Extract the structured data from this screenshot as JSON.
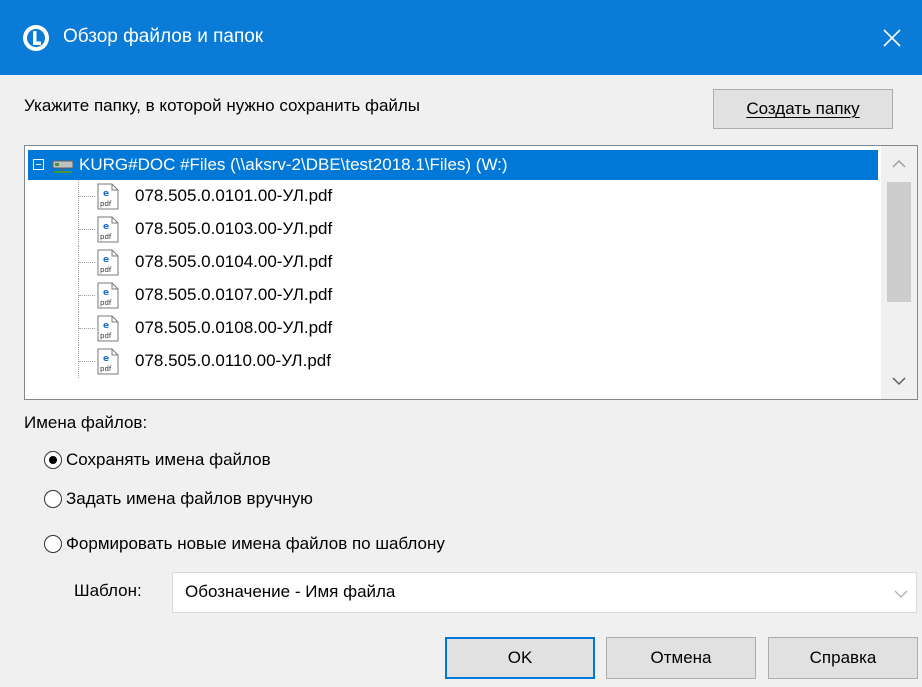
{
  "window": {
    "title": "Обзор файлов и папок",
    "title_bar_color": "#0a7bd6",
    "icon": "app-logo-icon",
    "close_icon": "close-icon"
  },
  "instruction": "Укажите папку, в которой нужно сохранить файлы",
  "create_folder_button": "Создать папку",
  "tree": {
    "root": {
      "label": "KURG#DOC #Files (\\\\aksrv-2\\DBE\\test2018.1\\Files) (W:)",
      "icon": "network-drive-icon",
      "expanded": true,
      "selected": true
    },
    "items": [
      {
        "label": "078.505.0.0101.00-УЛ.pdf",
        "icon": "pdf-file-icon"
      },
      {
        "label": "078.505.0.0103.00-УЛ.pdf",
        "icon": "pdf-file-icon"
      },
      {
        "label": "078.505.0.0104.00-УЛ.pdf",
        "icon": "pdf-file-icon"
      },
      {
        "label": "078.505.0.0107.00-УЛ.pdf",
        "icon": "pdf-file-icon"
      },
      {
        "label": "078.505.0.0108.00-УЛ.pdf",
        "icon": "pdf-file-icon"
      },
      {
        "label": "078.505.0.0110.00-УЛ.pdf",
        "icon": "pdf-file-icon"
      }
    ]
  },
  "file_names": {
    "label": "Имена файлов:",
    "options": [
      {
        "label": "Сохранять имена файлов",
        "checked": true
      },
      {
        "label": "Задать имена файлов вручную",
        "checked": false
      },
      {
        "label": "Формировать новые имена файлов по шаблону",
        "checked": false
      }
    ]
  },
  "template": {
    "label": "Шаблон:",
    "value": "Обозначение - Имя файла"
  },
  "buttons": {
    "ok": "OK",
    "cancel": "Отмена",
    "help": "Справка"
  },
  "colors": {
    "selection": "#0078d7",
    "dialog_background": "#f0f0f0"
  }
}
